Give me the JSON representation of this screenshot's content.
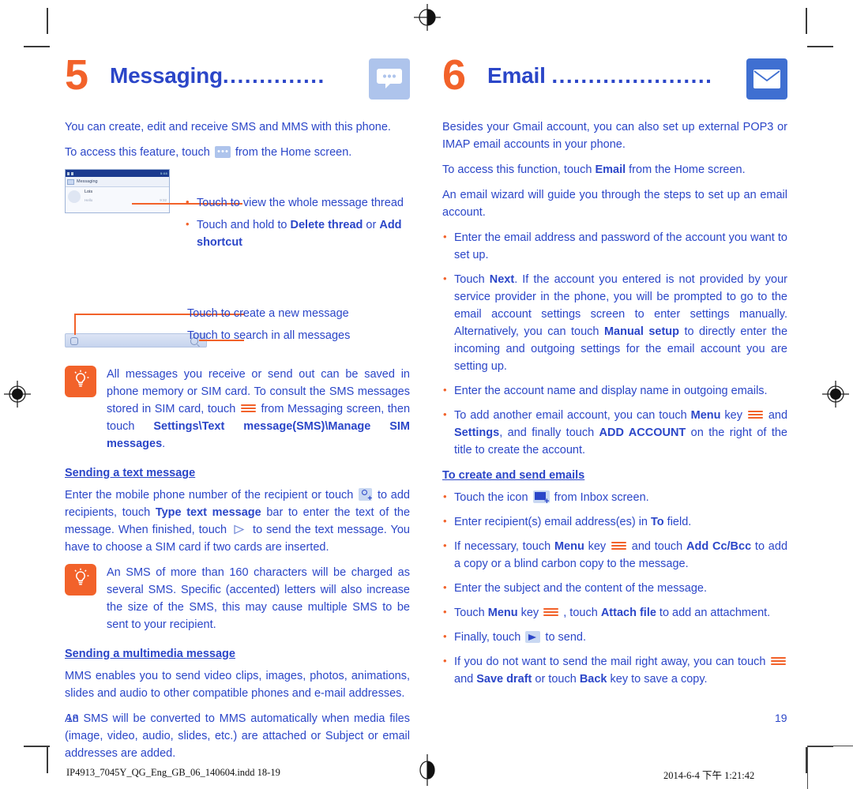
{
  "document": {
    "footer_file": "IP4913_7045Y_QG_Eng_GB_06_140604.indd   18-19",
    "footer_timestamp": "2014-6-4   下午 1:21:42",
    "page_left": "18",
    "page_right": "19",
    "colors": {
      "accent_orange": "#f2622a",
      "text_blue": "#2b46c8",
      "icon_light_blue": "#aec4ec",
      "icon_mail_blue": "#3f6fd1"
    }
  },
  "left_column": {
    "chapter": {
      "number": "5",
      "title": "Messaging",
      "dots": "..............",
      "icon": "message-bubble-icon"
    },
    "intro": {
      "line1": "You can create, edit and receive SMS and MMS with this phone.",
      "line2_before": "To access this feature, touch",
      "line2_icon": "message-bubble-icon",
      "line2_after": "from the Home screen."
    },
    "screenshot": {
      "status_right": "5:08",
      "title": "Messaging",
      "contact_name": "Lois",
      "preview": "Hello",
      "time": "9:32"
    },
    "callouts_top": [
      "Touch to view the whole message thread",
      "Touch and hold to Delete thread or Add shortcut"
    ],
    "callout_delete_bold": "Delete thread",
    "callout_addshortcut_bold": "Add shortcut",
    "callout_new_message": "Touch to create a new message",
    "callout_search": "Touch to search in all messages",
    "tip1": {
      "icon": "lightbulb-icon",
      "part1": "All messages you receive or send out can be saved in phone memory or SIM card. To consult the SMS messages stored in SIM card, touch",
      "menu_icon": "menu-key-icon",
      "part2": "from Messaging screen, then touch",
      "bold": "Settings\\Text message(SMS)\\Manage SIM messages",
      "part3": "."
    },
    "section_text": {
      "heading": "Sending a text message",
      "p1_a": "Enter the mobile phone number of the recipient or touch",
      "p1_icon": "add-person-icon",
      "p1_b": "to add recipients, touch",
      "p1_bold1": "Type text message",
      "p1_c": "bar to enter the text of the message. When finished, touch",
      "p1_icon2": "send-arrow-icon",
      "p1_d": "to send the text message. You have to choose a SIM card if two cards are inserted."
    },
    "tip2": {
      "icon": "lightbulb-icon",
      "text": "An SMS of more than 160 characters will be charged as several SMS. Specific (accented) letters will also increase the size of the SMS, this may cause multiple SMS to be sent to your recipient."
    },
    "section_mms": {
      "heading": "Sending a multimedia message",
      "p1": "MMS enables you to send video clips, images, photos, animations, slides and audio to other compatible phones and e-mail addresses.",
      "p2": "An SMS will be converted to MMS automatically when media files (image, video, audio, slides, etc.) are attached or Subject or email addresses are added."
    }
  },
  "right_column": {
    "chapter": {
      "number": "6",
      "title": "Email",
      "dots": "......................",
      "icon": "envelope-icon"
    },
    "intro": {
      "p1": "Besides your Gmail account, you can also set up external POP3 or IMAP email accounts in your phone.",
      "p2_a": "To access this function, touch",
      "p2_bold": "Email",
      "p2_b": "from the Home screen.",
      "p3": "An email wizard will guide you through the steps to set up an email account."
    },
    "setup_bullets": [
      {
        "a": "Enter the email address and password of the account you want to set up."
      },
      {
        "a": "Touch ",
        "bold1": "Next",
        "b": ". If the account you entered is not provided by your service provider in the phone, you will be prompted to go to the email account settings screen to enter settings manually. Alternatively, you can touch ",
        "bold2": "Manual setup",
        "c": " to directly enter the incoming and outgoing settings for the email account you are setting up."
      },
      {
        "a": "Enter the account name and display name in outgoing emails."
      },
      {
        "a": "To add another email account, you can touch ",
        "bold1": "Menu",
        "b": " key",
        "icon": "menu-key-icon",
        "c": "and ",
        "bold2": "Settings",
        "d": ", and finally touch ",
        "bold3": "ADD ACCOUNT",
        "e": " on the right of the title to create the account."
      }
    ],
    "create_section": {
      "heading": "To create and send emails",
      "bullets": [
        {
          "a": "Touch the icon",
          "icon": "compose-mail-icon",
          "b": "from Inbox screen."
        },
        {
          "a": "Enter recipient(s) email address(es) in ",
          "bold1": "To",
          "b": " field."
        },
        {
          "a": "If necessary, touch ",
          "bold1": "Menu",
          "b": " key",
          "icon": "menu-key-icon",
          "c": "and touch ",
          "bold2": "Add Cc/Bcc",
          "d": " to add a copy or a blind carbon copy to the message."
        },
        {
          "a": "Enter the subject and the content of the message."
        },
        {
          "a": "Touch ",
          "bold1": "Menu",
          "b": " key",
          "icon": "menu-key-icon",
          "c": ", touch ",
          "bold2": "Attach file",
          "d": " to add an attachment."
        },
        {
          "a": "Finally, touch",
          "icon": "send-arrow-icon",
          "b": "to send."
        },
        {
          "a": "If you do not want to send the mail right away, you can touch",
          "icon": "menu-key-icon",
          "b": "and ",
          "bold1": "Save draft",
          "c": " or touch ",
          "bold2": "Back",
          "d": " key to save a copy."
        }
      ]
    }
  }
}
